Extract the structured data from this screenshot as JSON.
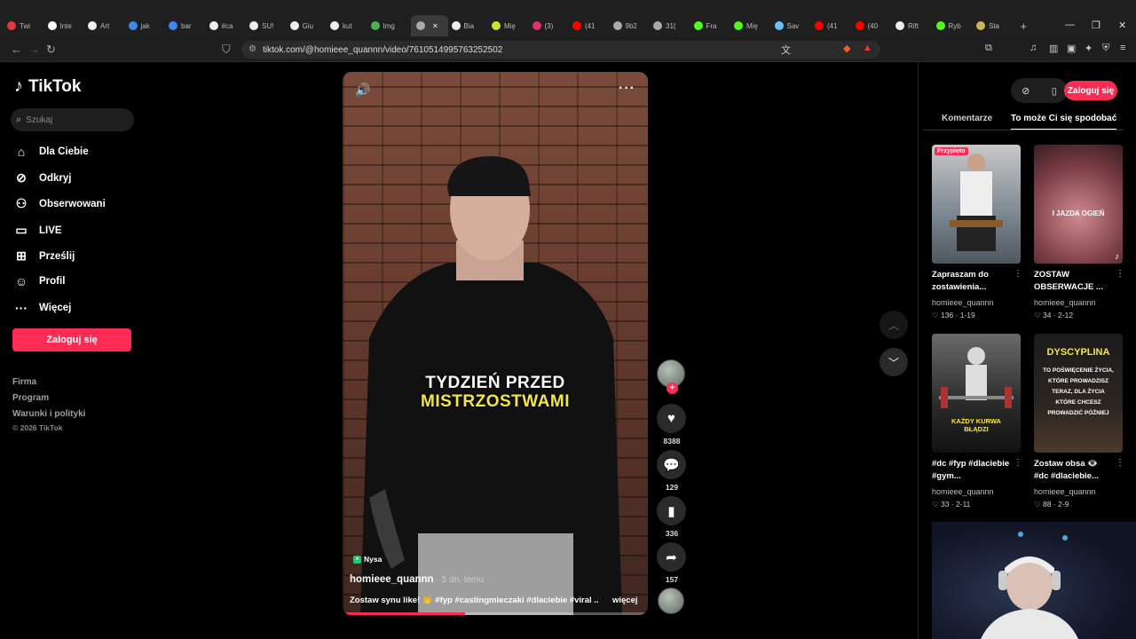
{
  "browser": {
    "tabs": [
      {
        "label": "Twi",
        "color": "#e53935"
      },
      {
        "label": "Inte",
        "color": "#fff"
      },
      {
        "label": "Art",
        "color": "#eee"
      },
      {
        "label": "jak",
        "color": "#4285f4"
      },
      {
        "label": "bar",
        "color": "#4285f4"
      },
      {
        "label": "#ca",
        "color": "#eee"
      },
      {
        "label": "SU!",
        "color": "#eee"
      },
      {
        "label": "Giu",
        "color": "#eee"
      },
      {
        "label": "kut",
        "color": "#eee"
      },
      {
        "label": "Img",
        "color": "#4caf50"
      },
      {
        "label": "",
        "color": "#aaa"
      },
      {
        "label": "Bia",
        "color": "#eee"
      },
      {
        "label": "Mię",
        "color": "#c6e52b"
      },
      {
        "label": "(3)",
        "color": "#e1306c"
      },
      {
        "label": "(41",
        "color": "#f00"
      },
      {
        "label": "9b2",
        "color": "#aaa"
      },
      {
        "label": "31(",
        "color": "#aaa"
      },
      {
        "label": "Fra",
        "color": "#53fc18"
      },
      {
        "label": "Mię",
        "color": "#53fc18"
      },
      {
        "label": "Sav",
        "color": "#66c0f4"
      },
      {
        "label": "(41",
        "color": "#f00"
      },
      {
        "label": "(40",
        "color": "#f00"
      },
      {
        "label": "Rift",
        "color": "#eee"
      },
      {
        "label": "Ryb",
        "color": "#53fc18"
      },
      {
        "label": "Sta",
        "color": "#c9b458"
      }
    ],
    "new_tab": "+",
    "url": "tiktok.com/@homieee_quannn/video/7610514995763252502"
  },
  "nav": {
    "brand": "TikTok",
    "search_placeholder": "Szukaj",
    "items": [
      {
        "label": "Dla Ciebie",
        "icon": "home-icon"
      },
      {
        "label": "Odkryj",
        "icon": "compass-icon"
      },
      {
        "label": "Obserwowani",
        "icon": "following-icon"
      },
      {
        "label": "LIVE",
        "icon": "live-icon"
      },
      {
        "label": "Prześlij",
        "icon": "upload-icon"
      },
      {
        "label": "Profil",
        "icon": "profile-icon"
      },
      {
        "label": "Więcej",
        "icon": "more-icon"
      }
    ],
    "login": "Zaloguj się",
    "footer": [
      "Firma",
      "Program",
      "Warunki i polityki"
    ],
    "copyright": "© 2026 TikTok"
  },
  "video": {
    "caption_line1": "TYDZIEŃ PRZED",
    "caption_line2": "MISTRZOSTWAMI",
    "location": "Nysa",
    "author": "homieee_quannn",
    "posted": "· 5 dn. temu",
    "description": "Zostaw synu like! 👏 #fyp #castingmieczaki #dlaciebie #viral ...",
    "more": "więcej",
    "progress": 0.4,
    "likes": "8388",
    "comments": "129",
    "saves": "336",
    "shares": "157"
  },
  "panel": {
    "login": "Zaloguj się",
    "tabs": [
      "Komentarze",
      "To może Ci się spodobać"
    ],
    "cards": [
      {
        "pinned": "Przypięto",
        "title": "Zapraszam do zostawienia...",
        "user": "homieee_quannn",
        "likes": "136",
        "date": "1-19",
        "overlay": ""
      },
      {
        "pinned": "",
        "title": "ZOSTAW OBSERWACJE ...",
        "user": "homieee_quannn",
        "likes": "34",
        "date": "2-12",
        "overlay": "I JAZDA OGIEŃ"
      },
      {
        "pinned": "",
        "title": "#dc #fyp #dlaciebie #gym...",
        "user": "homieee_quannn",
        "likes": "33",
        "date": "2-11",
        "overlay": "KAŻDY KURWA BŁĄDZI"
      },
      {
        "pinned": "",
        "title": "Zostaw obsa 👁️ #dc #dlaciebie...",
        "user": "homieee_quannn",
        "likes": "88",
        "date": "2-9",
        "overlay": "DYSCYPLINA",
        "overlay_sub": "TO POŚWIĘCENIE ŻYCIA, KTÓRE PROWADZISZ TERAZ, DLA ŻYCIA KTÓRE CHCESZ PROWADZIĆ PÓŹNIEJ"
      }
    ]
  }
}
